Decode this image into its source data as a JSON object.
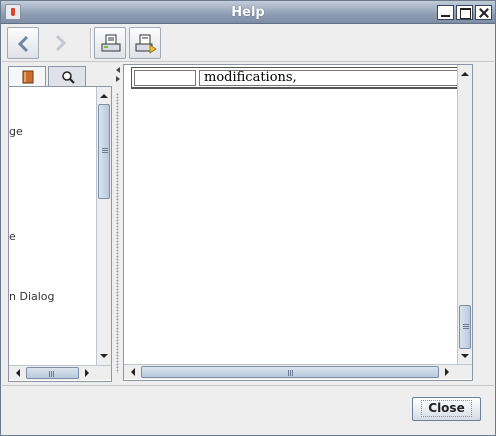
{
  "window": {
    "title": "Help"
  },
  "toolbar": {
    "buttons": [
      {
        "icon": "back-arrow-icon",
        "enabled": true
      },
      {
        "icon": "forward-arrow-icon",
        "enabled": false
      },
      {
        "icon": "print-icon",
        "enabled": true
      },
      {
        "icon": "page-setup-icon",
        "enabled": true
      }
    ]
  },
  "navigator": {
    "tabs": [
      {
        "icon": "book-icon",
        "selected": true
      },
      {
        "icon": "search-icon",
        "selected": false
      }
    ],
    "items": [
      {
        "label": "ge"
      },
      {
        "label": "e"
      },
      {
        "label": "n Dialog"
      }
    ]
  },
  "content": {
    "table_cells": [
      "",
      "modifications,"
    ]
  },
  "footer": {
    "close_label": "Close"
  },
  "colors": {
    "titlebar": "#8e9db2",
    "scroll_thumb": "#b8c8dc"
  }
}
